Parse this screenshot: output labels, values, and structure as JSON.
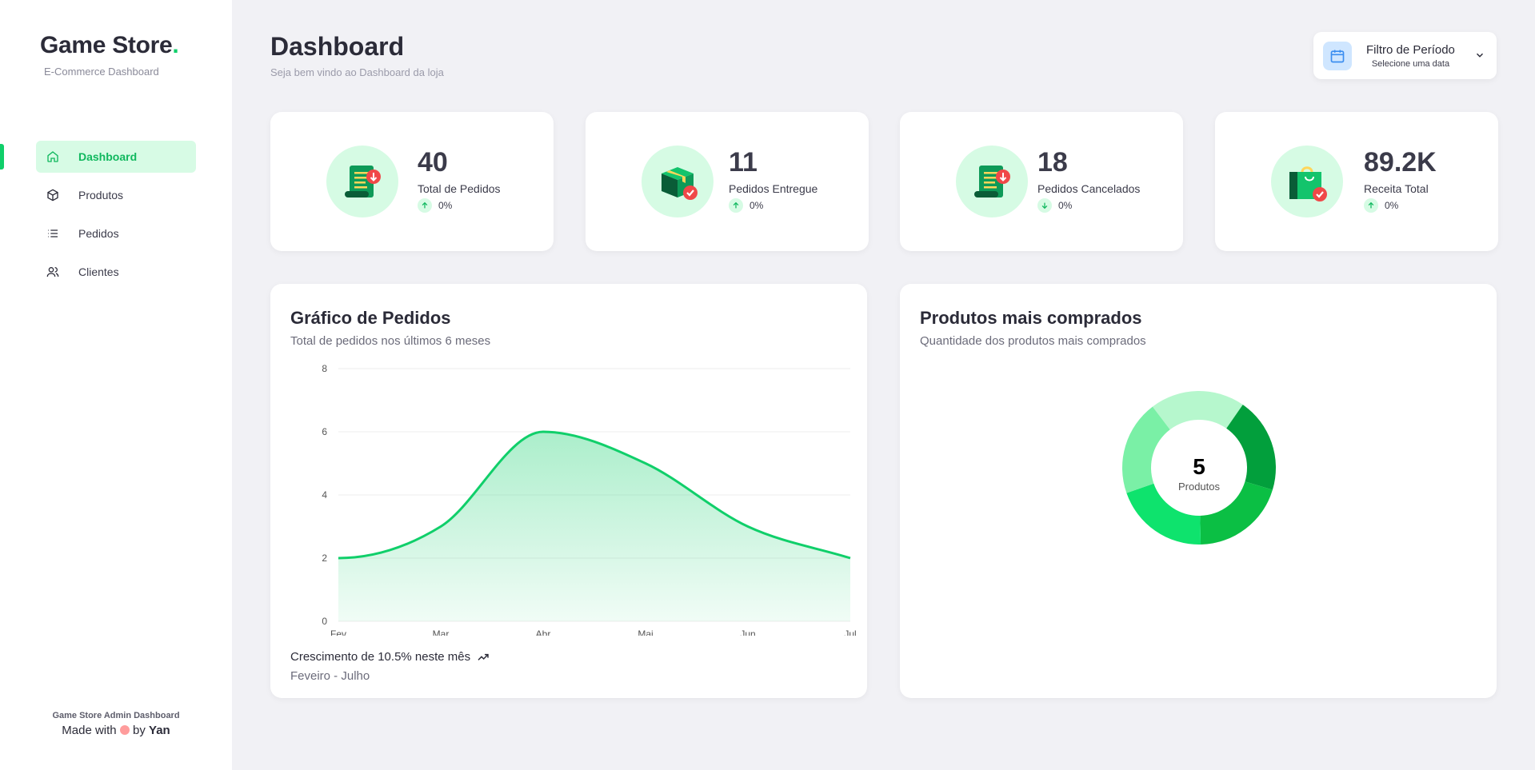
{
  "sidebar": {
    "brand_title": "Game Store",
    "brand_dot": ".",
    "brand_sub": "E-Commerce Dashboard",
    "items": [
      {
        "label": "Dashboard",
        "icon": "home-icon",
        "active": true
      },
      {
        "label": "Produtos",
        "icon": "box-icon",
        "active": false
      },
      {
        "label": "Pedidos",
        "icon": "list-icon",
        "active": false
      },
      {
        "label": "Clientes",
        "icon": "users-icon",
        "active": false
      }
    ],
    "footer_line1": "Game Store Admin Dashboard",
    "footer_made": "Made with",
    "footer_by": "by",
    "footer_author": "Yan"
  },
  "header": {
    "title": "Dashboard",
    "subtitle": "Seja bem vindo ao Dashboard da loja",
    "filter_title": "Filtro de Período",
    "filter_sub": "Selecione uma data"
  },
  "stats": [
    {
      "value": "40",
      "label": "Total de Pedidos",
      "trend": "0%",
      "trend_dir": "up",
      "icon": "receipt-icon"
    },
    {
      "value": "11",
      "label": "Pedidos Entregue",
      "trend": "0%",
      "trend_dir": "up",
      "icon": "package-delivered-icon"
    },
    {
      "value": "18",
      "label": "Pedidos Cancelados",
      "trend": "0%",
      "trend_dir": "down",
      "icon": "receipt-icon"
    },
    {
      "value": "89.2K",
      "label": "Receita Total",
      "trend": "0%",
      "trend_dir": "up",
      "icon": "shopping-bag-icon"
    }
  ],
  "orders_panel": {
    "title": "Gráfico de Pedidos",
    "subtitle": "Total de pedidos nos últimos 6 meses",
    "growth_text": "Crescimento de 10.5% neste mês",
    "period": "Feveiro - Julho"
  },
  "products_panel": {
    "title": "Produtos mais comprados",
    "subtitle": "Quantidade dos produtos mais comprados",
    "center_value": "5",
    "center_label": "Produtos"
  },
  "colors": {
    "accent": "#10cf6a",
    "accent_light": "#d7fbe5"
  },
  "chart_data": [
    {
      "type": "area",
      "categories": [
        "Fev",
        "Mar",
        "Abr",
        "Mai",
        "Jun",
        "Jul"
      ],
      "series": [
        {
          "values": [
            2,
            3,
            6,
            5,
            3,
            2
          ]
        }
      ],
      "ylim": [
        0,
        8
      ],
      "yticks": [
        0,
        2,
        4,
        6,
        8
      ],
      "grid": true
    },
    {
      "type": "pie",
      "donut": true,
      "values": [
        1,
        1,
        1,
        1,
        1
      ],
      "colors": [
        "#b6f7cd",
        "#029f3c",
        "#0bbf44",
        "#0ee36d",
        "#7af0a6"
      ]
    }
  ]
}
